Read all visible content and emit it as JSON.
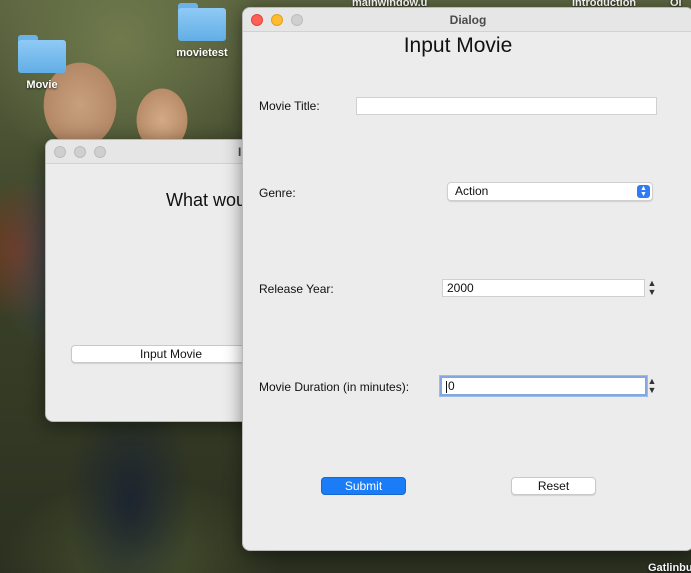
{
  "desktop": {
    "icons": [
      {
        "label": "Movie"
      },
      {
        "label": "movietest"
      }
    ],
    "edge_labels": {
      "top_mainwindow": "mainwindow.u",
      "top_introduction": "Introduction",
      "top_right": "Ol",
      "bottom_right": "Gatlinbu"
    }
  },
  "back_window": {
    "title_fragment": "I",
    "heading": "What woul",
    "button_label": "Input Movie"
  },
  "dialog": {
    "title": "Dialog",
    "heading": "Input Movie",
    "fields": {
      "title_label": "Movie Title:",
      "title_value": "",
      "genre_label": "Genre:",
      "genre_value": "Action",
      "year_label": "Release Year:",
      "year_value": "2000",
      "duration_label": "Movie Duration (in minutes):",
      "duration_value": "0"
    },
    "buttons": {
      "submit": "Submit",
      "reset": "Reset"
    },
    "colors": {
      "accent": "#1a7cf6",
      "focus_ring": "#83a8de"
    }
  }
}
